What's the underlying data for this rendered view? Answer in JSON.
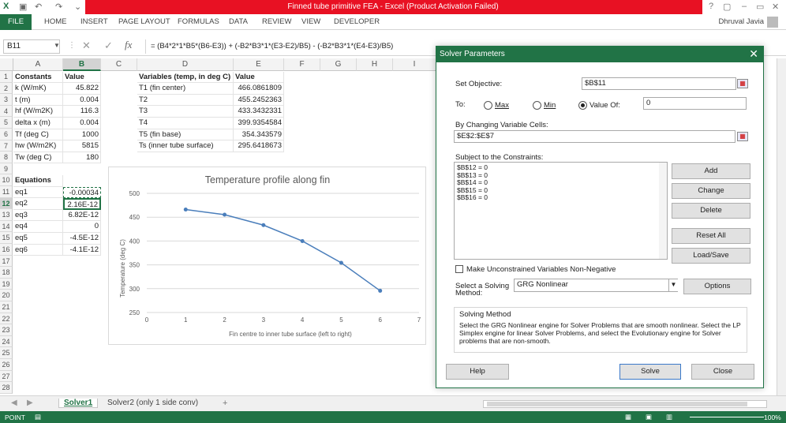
{
  "window": {
    "title": "Finned tube primitive FEA -  Excel (Product Activation Failed)",
    "user": "Dhruval Javia",
    "help_q": "?",
    "quick_access": [
      "save-icon",
      "undo-icon",
      "redo-icon",
      "customize-icon"
    ],
    "controls": {
      "help": "?",
      "restore": "▢",
      "minimize": "–",
      "maximize": "▭",
      "close": "✕"
    }
  },
  "ribbon": {
    "tabs": [
      "FILE",
      "HOME",
      "INSERT",
      "PAGE LAYOUT",
      "FORMULAS",
      "DATA",
      "REVIEW",
      "VIEW",
      "DEVELOPER"
    ]
  },
  "formula_bar": {
    "name_box": "B11",
    "fx": "fx",
    "formula": "= (B4*2*1*B5*(B6-E3)) + (-B2*B3*1*(E3-E2)/B5) - (-B2*B3*1*(E4-E3)/B5)"
  },
  "sheet": {
    "columns": [
      "A",
      "B",
      "C",
      "D",
      "E",
      "F",
      "G",
      "H",
      "I"
    ],
    "rows": [
      "1",
      "2",
      "3",
      "4",
      "5",
      "6",
      "7",
      "8",
      "9",
      "10",
      "11",
      "12",
      "13",
      "14",
      "15",
      "16",
      "17",
      "18",
      "19",
      "20",
      "21",
      "22",
      "23",
      "24",
      "25",
      "26",
      "27",
      "28"
    ],
    "cells": {
      "A1": "Constants",
      "B1": "Value",
      "D1": "Variables (temp, in deg C)",
      "E1": "Value",
      "A2": "k (W/mK)",
      "B2": "45.822",
      "D2": "T1 (fin center)",
      "E2": "466.0861809",
      "A3": "t (m)",
      "B3": "0.004",
      "D3": "T2",
      "E3": "455.2452363",
      "A4": "hf (W/m2K)",
      "B4": "116.3",
      "D4": "T3",
      "E4": "433.3432331",
      "A5": "delta x (m)",
      "B5": "0.004",
      "D5": "T4",
      "E5": "399.9354584",
      "A6": "Tf (deg C)",
      "B6": "1000",
      "D6": "T5 (fin base)",
      "E6": "354.343579",
      "A7": "hw (W/m2K)",
      "B7": "5815",
      "D7": "Ts (inner tube surface)",
      "E7": "295.6418673",
      "A8": "Tw (deg C)",
      "B8": "180",
      "A10": "Equations",
      "A11": "eq1",
      "B11": "-0.00034",
      "A12": "eq2",
      "B12": "2.16E-12",
      "A13": "eq3",
      "B13": "6.82E-12",
      "A14": "eq4",
      "B14": "0",
      "A15": "eq5",
      "B15": "-4.5E-12",
      "A16": "eq6",
      "B16": "-4.1E-12"
    },
    "tabs": [
      "Solver1",
      "Solver2 (only 1 side conv)"
    ],
    "add_sheet": "+"
  },
  "chart_data": {
    "type": "line",
    "title": "Temperature profile along fin",
    "xlabel": "Fin centre to inner tube surface (left to right)",
    "ylabel": "Temperature (deg C)",
    "x": [
      1,
      2,
      3,
      4,
      5,
      6
    ],
    "series": [
      {
        "values": [
          466.086,
          455.245,
          433.343,
          399.935,
          354.344,
          295.642
        ]
      }
    ],
    "xlim": [
      0,
      7
    ],
    "ylim": [
      250,
      500
    ],
    "xticks": [
      "0",
      "1",
      "2",
      "3",
      "4",
      "5",
      "6",
      "7"
    ],
    "yticks": [
      "250",
      "300",
      "350",
      "400",
      "450",
      "500"
    ],
    "grid": true,
    "color": "#4a7ebb"
  },
  "status": {
    "mode": "POINT",
    "zoom": "100%"
  },
  "solver": {
    "title": "Solver Parameters",
    "set_objective_label": "Set Objective:",
    "set_objective_value": "$B$11",
    "to_label": "To:",
    "max_label": "Max",
    "min_label": "Min",
    "value_of_label": "Value Of:",
    "value_of_input": "0",
    "changing_label": "By Changing Variable Cells:",
    "changing_value": "$E$2:$E$7",
    "constraints_label": "Subject to the Constraints:",
    "constraints": [
      "$B$12 = 0",
      "$B$13 = 0",
      "$B$14 = 0",
      "$B$15 = 0",
      "$B$16 = 0"
    ],
    "buttons": {
      "add": "Add",
      "change": "Change",
      "delete": "Delete",
      "reset": "Reset All",
      "loadsave": "Load/Save",
      "options": "Options",
      "help": "Help",
      "solve": "Solve",
      "close": "Close"
    },
    "nonneg_label": "Make Unconstrained Variables Non-Negative",
    "method_label_1": "Select a Solving",
    "method_label_2": "Method:",
    "method_value": "GRG Nonlinear",
    "solving_method_title": "Solving Method",
    "solving_method_text": "Select the GRG Nonlinear engine for Solver Problems that are smooth nonlinear. Select the LP Simplex engine for linear Solver Problems, and select the Evolutionary engine for Solver problems that are non-smooth."
  }
}
